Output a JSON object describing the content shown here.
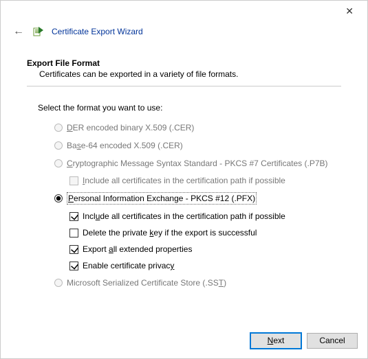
{
  "window": {
    "close_glyph": "✕"
  },
  "header": {
    "back_glyph": "←",
    "title": "Certificate Export Wizard"
  },
  "section": {
    "title": "Export File Format",
    "description": "Certificates can be exported in a variety of file formats."
  },
  "prompt": "Select the format you want to use:",
  "options": {
    "der": {
      "key": "D",
      "rest": "ER encoded binary X.509 (.CER)"
    },
    "base64": {
      "pre": "Ba",
      "key": "s",
      "rest": "e-64 encoded X.509 (.CER)"
    },
    "pkcs7": {
      "key": "C",
      "rest": "ryptographic Message Syntax Standard - PKCS #7 Certificates (.P7B)"
    },
    "pkcs7_sub": {
      "key": "I",
      "rest": "nclude all certificates in the certification path if possible"
    },
    "pfx": {
      "key": "P",
      "rest": "ersonal Information Exchange - PKCS #12 (.PFX)"
    },
    "pfx_include": {
      "pre": "Incl",
      "key": "u",
      "rest": "de all certificates in the certification path if possible"
    },
    "pfx_delete": {
      "pre": "Delete the private ",
      "key": "k",
      "rest": "ey if the export is successful"
    },
    "pfx_ext": {
      "pre": "Export ",
      "key": "a",
      "rest": "ll extended properties"
    },
    "pfx_privacy": {
      "pre": "Enable certificate privac",
      "key": "y",
      "rest": ""
    },
    "sst": {
      "pre": "Microsoft Serialized Certificate Store (.SS",
      "key": "T",
      "rest": ")"
    }
  },
  "buttons": {
    "next_key": "N",
    "next_rest": "ext",
    "cancel": "Cancel"
  }
}
